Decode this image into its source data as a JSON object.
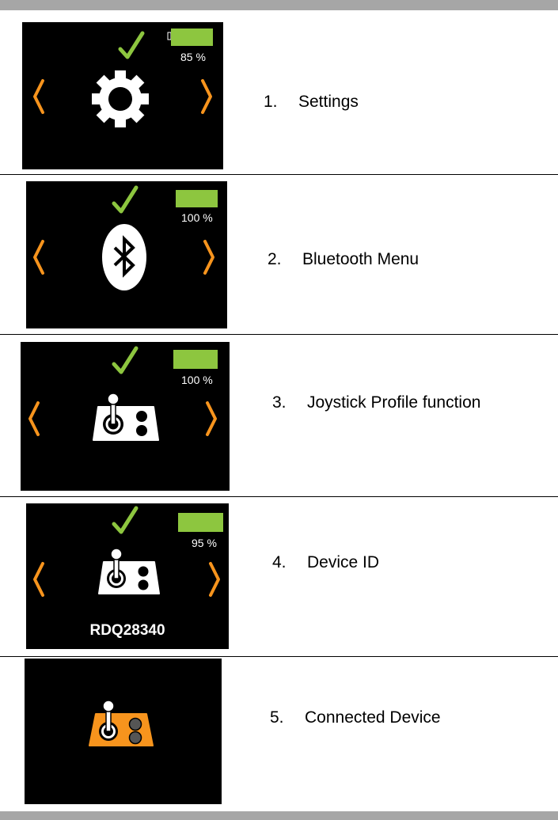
{
  "colors": {
    "accent_orange": "#f7941d",
    "check_green": "#8dc63f",
    "battery_green": "#8dc63f",
    "screen_bg": "#000000"
  },
  "rows": [
    {
      "number": "1.",
      "caption": "Settings",
      "battery": "85 %",
      "battery_level": 0.85,
      "icon": "gear-icon"
    },
    {
      "number": "2.",
      "caption": "Bluetooth Menu",
      "battery": "100 %",
      "battery_level": 1.0,
      "icon": "bluetooth-icon"
    },
    {
      "number": "3.",
      "caption": "Joystick Profile function",
      "battery": "100 %",
      "battery_level": 1.0,
      "icon": "joystick-icon"
    },
    {
      "number": "4.",
      "caption": "Device ID",
      "battery": "95 %",
      "battery_level": 0.95,
      "icon": "joystick-icon",
      "device_id": "RDQ28340"
    },
    {
      "number": "5.",
      "caption": "Connected Device",
      "icon": "joystick-connected-icon"
    }
  ]
}
